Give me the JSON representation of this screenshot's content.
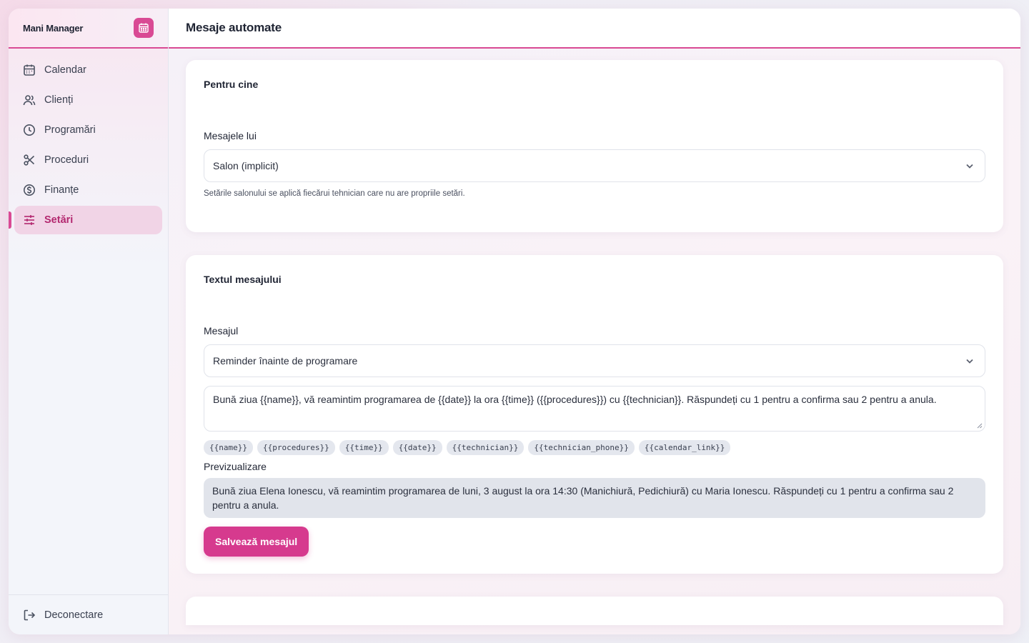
{
  "sidebar": {
    "brand": "Mani Manager",
    "items": [
      {
        "label": "Calendar",
        "icon": "calendar-icon"
      },
      {
        "label": "Clienți",
        "icon": "users-icon"
      },
      {
        "label": "Programări",
        "icon": "clock-icon"
      },
      {
        "label": "Proceduri",
        "icon": "scissors-icon"
      },
      {
        "label": "Finanțe",
        "icon": "dollar-icon"
      },
      {
        "label": "Setări",
        "icon": "sliders-icon",
        "active": true
      }
    ],
    "logout": "Deconectare"
  },
  "header": {
    "title": "Mesaje automate"
  },
  "recipient_card": {
    "title": "Pentru cine",
    "field_label": "Mesajele lui",
    "selected": "Salon (implicit)",
    "hint": "Setările salonului se aplică fiecărui tehnician care nu are propriile setări."
  },
  "message_card": {
    "title": "Textul mesajului",
    "field_label": "Mesajul",
    "selected": "Reminder înainte de programare",
    "template_text": "Bună ziua {{name}}, vă reamintim programarea de {{date}} la ora {{time}} ({{procedures}}) cu {{technician}}. Răspundeți cu 1 pentru a confirma sau 2 pentru a anula.",
    "tags": [
      "{{name}}",
      "{{procedures}}",
      "{{time}}",
      "{{date}}",
      "{{technician}}",
      "{{technician_phone}}",
      "{{calendar_link}}"
    ],
    "preview_label": "Previzualizare",
    "preview_text": "Bună ziua Elena Ionescu, vă reamintim programarea de luni, 3 august la ora 14:30 (Manichiură, Pedichiură) cu Maria Ionescu. Răspundeți cu 1 pentru a confirma sau 2 pentru a anula.",
    "save_label": "Salvează mesajul"
  },
  "colors": {
    "accent": "#d94a94",
    "button": "#d63a8e"
  }
}
